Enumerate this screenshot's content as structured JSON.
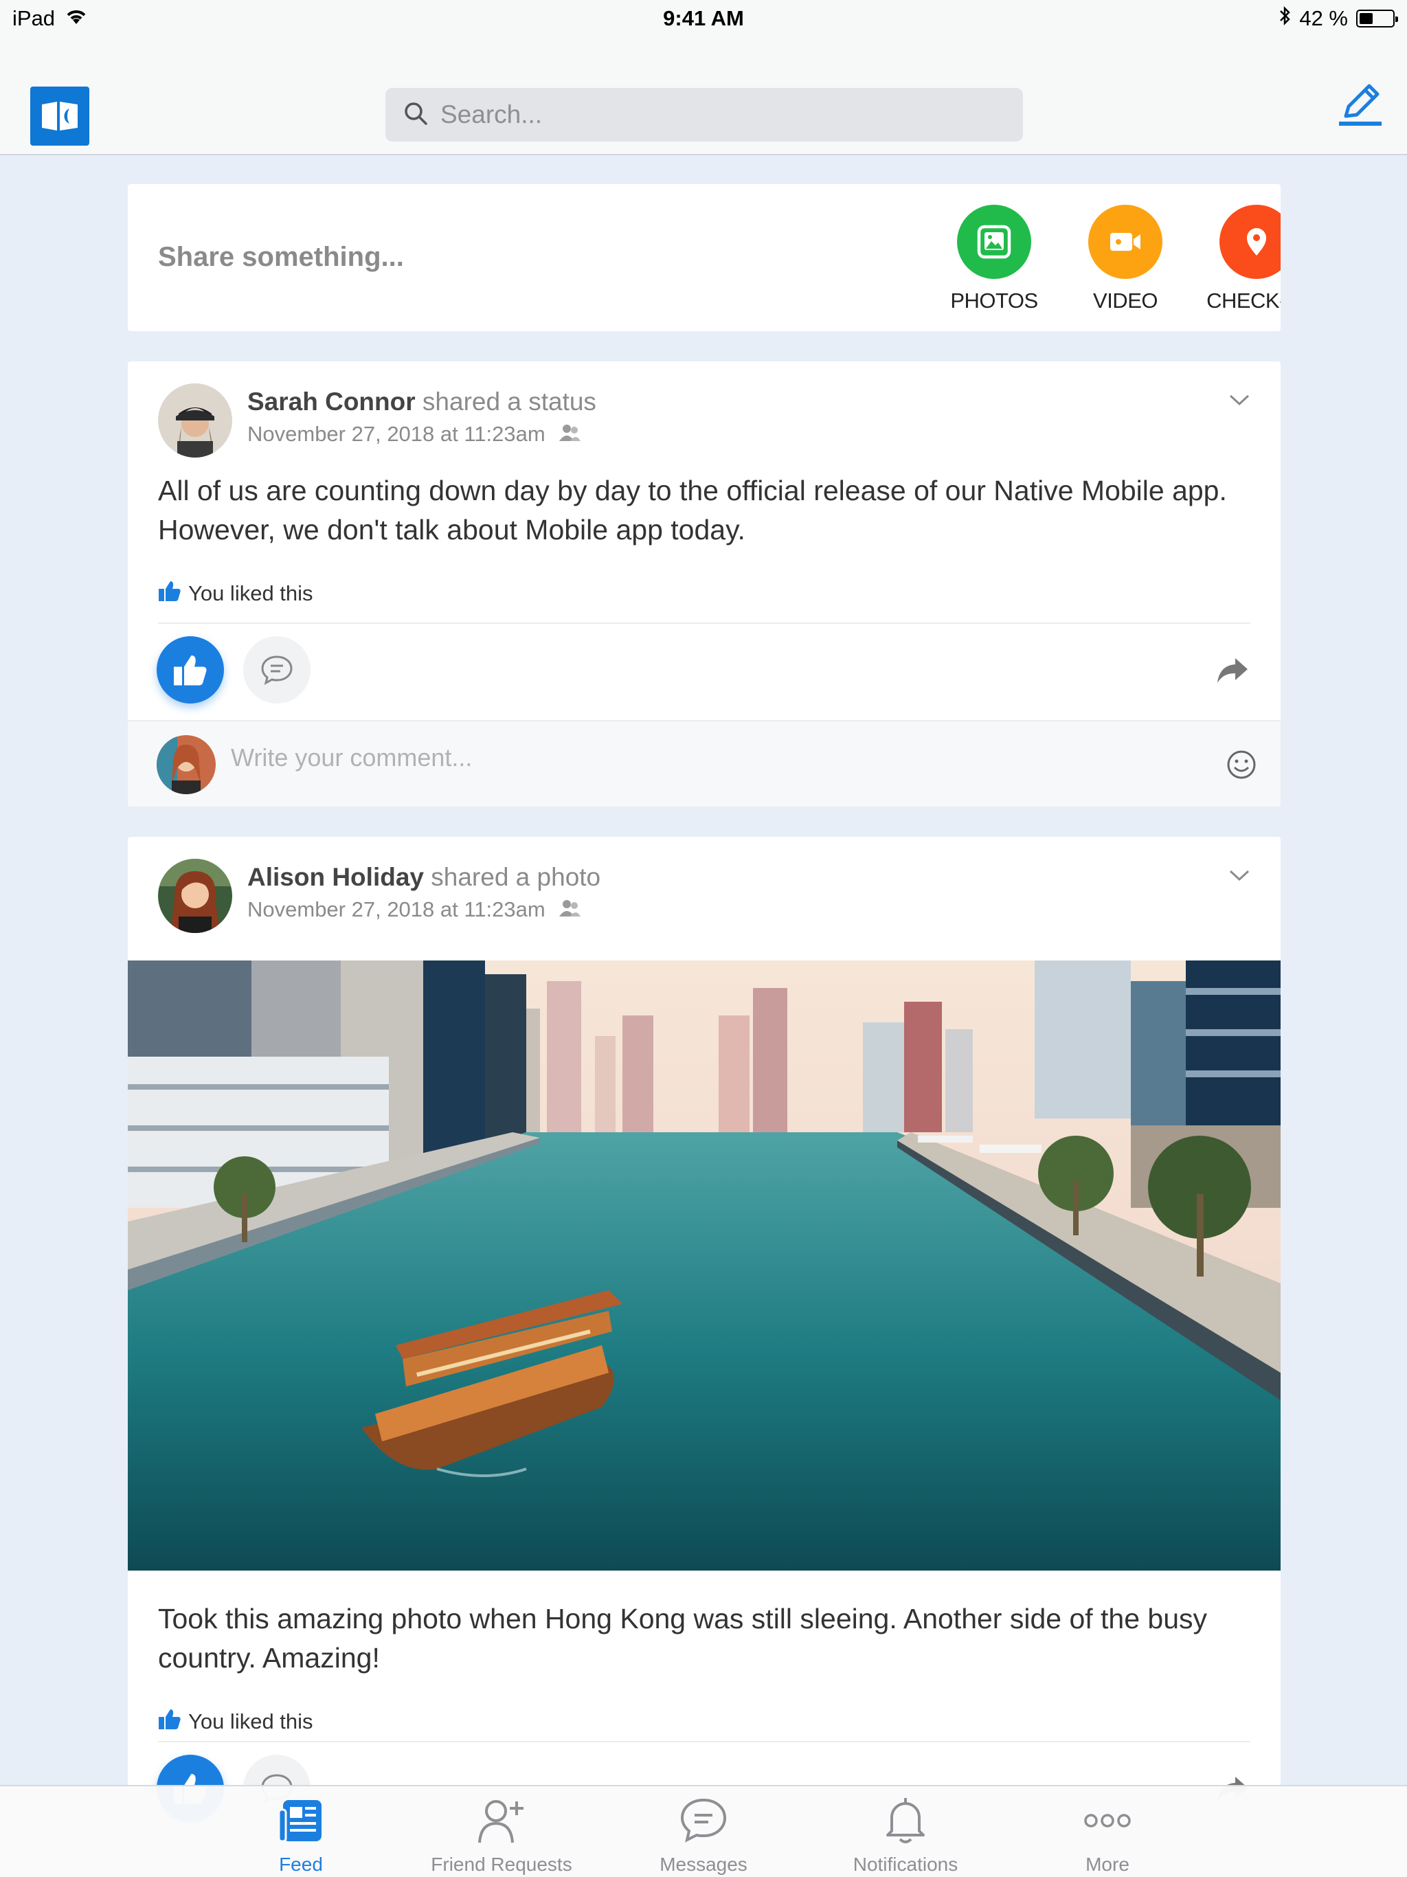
{
  "status_bar": {
    "device": "iPad",
    "time": "9:41 AM",
    "battery": "42 %",
    "battery_level": 0.42
  },
  "nav": {
    "logo_icon": "app-logo-icon",
    "search_placeholder": "Search...",
    "compose_icon": "compose-icon"
  },
  "share": {
    "prompt": "Share something...",
    "actions": [
      {
        "label": "PHOTOS",
        "icon": "photos-icon",
        "color": "#21bb4b"
      },
      {
        "label": "VIDEO",
        "icon": "video-icon",
        "color": "#fda312"
      },
      {
        "label": "CHECK-IN",
        "icon": "location-pin-icon",
        "color": "#fb4c1c"
      }
    ]
  },
  "posts": [
    {
      "author": "Sarah Connor",
      "action": "shared a status",
      "date": "November 27, 2018 at 11:23am",
      "text": "All of us are counting down day by day to the official release of our Native Mobile app. However, we don't talk about Mobile app today.",
      "liked_text": "You liked this",
      "comment_placeholder": "Write your comment..."
    },
    {
      "author": "Alison Holiday",
      "action": "shared a photo",
      "date": "November 27, 2018 at 11:23am",
      "text": "Took this amazing photo when Hong Kong was still sleeing. Another side of the busy country. Amazing!",
      "liked_text": "You liked this"
    }
  ],
  "tabs": [
    {
      "label": "Feed",
      "icon": "feed-icon",
      "active": true
    },
    {
      "label": "Friend Requests",
      "icon": "add-friend-icon",
      "active": false
    },
    {
      "label": "Messages",
      "icon": "messages-icon",
      "active": false
    },
    {
      "label": "Notifications",
      "icon": "bell-icon",
      "active": false
    },
    {
      "label": "More",
      "icon": "more-icon",
      "active": false
    }
  ],
  "colors": {
    "accent": "#1b7fe0",
    "background": "#e7eef8"
  }
}
